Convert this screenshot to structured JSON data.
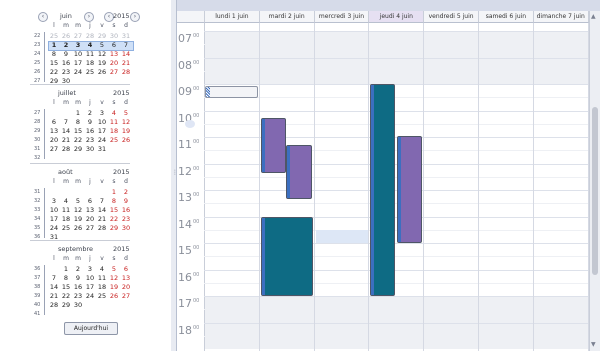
{
  "navigator": {
    "dow": [
      "l",
      "m",
      "m",
      "j",
      "v",
      "s",
      "d"
    ],
    "prev_icon": "chevron-left-icon",
    "next_icon": "chevron-right-icon",
    "today_label": "Aujourd'hui",
    "months": [
      {
        "name": "juin",
        "year": "2015",
        "nav": true,
        "weeks": [
          {
            "wk": "22",
            "days": [
              {
                "t": "25",
                "o": 1
              },
              {
                "t": "26",
                "o": 1
              },
              {
                "t": "27",
                "o": 1
              },
              {
                "t": "28",
                "o": 1
              },
              {
                "t": "29",
                "o": 1
              },
              {
                "t": "30",
                "o": 1
              },
              {
                "t": "31",
                "o": 1
              }
            ]
          },
          {
            "wk": "23",
            "days": [
              {
                "t": "1",
                "b": 1
              },
              {
                "t": "2",
                "b": 1
              },
              {
                "t": "3",
                "b": 1
              },
              {
                "t": "4",
                "b": 1
              },
              {
                "t": "5"
              },
              {
                "t": "6"
              },
              {
                "t": "7"
              }
            ]
          },
          {
            "wk": "24",
            "days": [
              {
                "t": "8"
              },
              {
                "t": "9"
              },
              {
                "t": "10"
              },
              {
                "t": "11"
              },
              {
                "t": "12"
              },
              {
                "t": "13",
                "w": 1
              },
              {
                "t": "14",
                "w": 1
              }
            ]
          },
          {
            "wk": "25",
            "days": [
              {
                "t": "15"
              },
              {
                "t": "16"
              },
              {
                "t": "17"
              },
              {
                "t": "18"
              },
              {
                "t": "19"
              },
              {
                "t": "20",
                "w": 1
              },
              {
                "t": "21",
                "w": 1
              }
            ]
          },
          {
            "wk": "26",
            "days": [
              {
                "t": "22"
              },
              {
                "t": "23"
              },
              {
                "t": "24"
              },
              {
                "t": "25"
              },
              {
                "t": "26"
              },
              {
                "t": "27",
                "w": 1
              },
              {
                "t": "28",
                "w": 1
              }
            ]
          },
          {
            "wk": "27",
            "days": [
              {
                "t": "29"
              },
              {
                "t": "30"
              },
              {
                "t": ""
              },
              {
                "t": ""
              },
              {
                "t": ""
              },
              {
                "t": ""
              },
              {
                "t": ""
              }
            ]
          }
        ]
      },
      {
        "name": "juillet",
        "year": "2015",
        "nav": false,
        "weeks": [
          {
            "wk": "27",
            "days": [
              {
                "t": ""
              },
              {
                "t": ""
              },
              {
                "t": "1"
              },
              {
                "t": "2"
              },
              {
                "t": "3"
              },
              {
                "t": "4",
                "w": 1
              },
              {
                "t": "5",
                "w": 1
              }
            ]
          },
          {
            "wk": "28",
            "days": [
              {
                "t": "6"
              },
              {
                "t": "7"
              },
              {
                "t": "8"
              },
              {
                "t": "9"
              },
              {
                "t": "10"
              },
              {
                "t": "11",
                "w": 1
              },
              {
                "t": "12",
                "w": 1
              }
            ]
          },
          {
            "wk": "29",
            "days": [
              {
                "t": "13"
              },
              {
                "t": "14"
              },
              {
                "t": "15"
              },
              {
                "t": "16"
              },
              {
                "t": "17"
              },
              {
                "t": "18",
                "w": 1
              },
              {
                "t": "19",
                "w": 1
              }
            ]
          },
          {
            "wk": "30",
            "days": [
              {
                "t": "20"
              },
              {
                "t": "21"
              },
              {
                "t": "22"
              },
              {
                "t": "23"
              },
              {
                "t": "24"
              },
              {
                "t": "25",
                "w": 1
              },
              {
                "t": "26",
                "w": 1
              }
            ]
          },
          {
            "wk": "31",
            "days": [
              {
                "t": "27"
              },
              {
                "t": "28"
              },
              {
                "t": "29"
              },
              {
                "t": "30"
              },
              {
                "t": "31"
              },
              {
                "t": ""
              },
              {
                "t": ""
              }
            ]
          },
          {
            "wk": "32",
            "days": [
              {
                "t": ""
              },
              {
                "t": ""
              },
              {
                "t": ""
              },
              {
                "t": ""
              },
              {
                "t": ""
              },
              {
                "t": ""
              },
              {
                "t": ""
              }
            ]
          }
        ]
      },
      {
        "name": "août",
        "year": "2015",
        "nav": false,
        "weeks": [
          {
            "wk": "31",
            "days": [
              {
                "t": ""
              },
              {
                "t": ""
              },
              {
                "t": ""
              },
              {
                "t": ""
              },
              {
                "t": ""
              },
              {
                "t": "1",
                "w": 1
              },
              {
                "t": "2",
                "w": 1
              }
            ]
          },
          {
            "wk": "32",
            "days": [
              {
                "t": "3"
              },
              {
                "t": "4"
              },
              {
                "t": "5"
              },
              {
                "t": "6"
              },
              {
                "t": "7"
              },
              {
                "t": "8",
                "w": 1
              },
              {
                "t": "9",
                "w": 1
              }
            ]
          },
          {
            "wk": "33",
            "days": [
              {
                "t": "10"
              },
              {
                "t": "11"
              },
              {
                "t": "12"
              },
              {
                "t": "13"
              },
              {
                "t": "14"
              },
              {
                "t": "15",
                "w": 1
              },
              {
                "t": "16",
                "w": 1
              }
            ]
          },
          {
            "wk": "34",
            "days": [
              {
                "t": "17"
              },
              {
                "t": "18"
              },
              {
                "t": "19"
              },
              {
                "t": "20"
              },
              {
                "t": "21"
              },
              {
                "t": "22",
                "w": 1
              },
              {
                "t": "23",
                "w": 1
              }
            ]
          },
          {
            "wk": "35",
            "days": [
              {
                "t": "24"
              },
              {
                "t": "25"
              },
              {
                "t": "26"
              },
              {
                "t": "27"
              },
              {
                "t": "28"
              },
              {
                "t": "29",
                "w": 1
              },
              {
                "t": "30",
                "w": 1
              }
            ]
          },
          {
            "wk": "36",
            "days": [
              {
                "t": "31"
              },
              {
                "t": ""
              },
              {
                "t": ""
              },
              {
                "t": ""
              },
              {
                "t": ""
              },
              {
                "t": ""
              },
              {
                "t": ""
              }
            ]
          }
        ]
      },
      {
        "name": "septembre",
        "year": "2015",
        "nav": false,
        "weeks": [
          {
            "wk": "36",
            "days": [
              {
                "t": ""
              },
              {
                "t": "1"
              },
              {
                "t": "2"
              },
              {
                "t": "3"
              },
              {
                "t": "4"
              },
              {
                "t": "5",
                "w": 1
              },
              {
                "t": "6",
                "w": 1
              }
            ]
          },
          {
            "wk": "37",
            "days": [
              {
                "t": "7"
              },
              {
                "t": "8"
              },
              {
                "t": "9"
              },
              {
                "t": "10"
              },
              {
                "t": "11"
              },
              {
                "t": "12",
                "w": 1
              },
              {
                "t": "13",
                "w": 1
              }
            ]
          },
          {
            "wk": "38",
            "days": [
              {
                "t": "14"
              },
              {
                "t": "15"
              },
              {
                "t": "16"
              },
              {
                "t": "17"
              },
              {
                "t": "18"
              },
              {
                "t": "19",
                "w": 1
              },
              {
                "t": "20",
                "w": 1
              }
            ]
          },
          {
            "wk": "39",
            "days": [
              {
                "t": "21"
              },
              {
                "t": "22"
              },
              {
                "t": "23"
              },
              {
                "t": "24"
              },
              {
                "t": "25"
              },
              {
                "t": "26",
                "w": 1
              },
              {
                "t": "27",
                "w": 1
              }
            ]
          },
          {
            "wk": "40",
            "days": [
              {
                "t": "28"
              },
              {
                "t": "29"
              },
              {
                "t": "30"
              },
              {
                "t": ""
              },
              {
                "t": ""
              },
              {
                "t": ""
              },
              {
                "t": ""
              }
            ]
          },
          {
            "wk": "41",
            "days": [
              {
                "t": ""
              },
              {
                "t": ""
              },
              {
                "t": ""
              },
              {
                "t": ""
              },
              {
                "t": ""
              },
              {
                "t": ""
              },
              {
                "t": ""
              }
            ]
          }
        ]
      }
    ]
  },
  "week_view": {
    "days": [
      "lundi 1 juin",
      "mardi 2 juin",
      "mercredi 3 juin",
      "jeudi 4 juin",
      "vendredi 5 juin",
      "samedi 6 juin",
      "dimanche 7 juin"
    ],
    "today_index": 3,
    "hours": [
      "07",
      "08",
      "09",
      "10",
      "11",
      "12",
      "13",
      "14",
      "15",
      "16",
      "17",
      "18"
    ],
    "minutes_suffix": "00",
    "first_hour": 7,
    "events": [
      {
        "day": 0,
        "start": 9.0,
        "end": 9.5,
        "kind": "allday-tentative"
      },
      {
        "day": 1,
        "start": 10.3,
        "end": 12.35,
        "color": "purple"
      },
      {
        "day": 1,
        "start": 14.0,
        "end": 17.0,
        "color": "teal"
      },
      {
        "day": 1,
        "start": 11.3,
        "end": 13.35,
        "color": "purple",
        "offset": 1
      },
      {
        "day": 3,
        "start": 9.0,
        "end": 17.0,
        "color": "teal"
      },
      {
        "day": 3,
        "start": 10.95,
        "end": 15.0,
        "color": "purple",
        "offset": 1
      }
    ],
    "selection": {
      "day": 2,
      "start": 14.5,
      "end": 15.0
    },
    "colors": {
      "purple": "#8168b0",
      "teal": "#0e6b84",
      "status_bar": "#3c6fc0",
      "today_header": "#e6e0f2",
      "off_hours": "#eef0f4"
    }
  }
}
